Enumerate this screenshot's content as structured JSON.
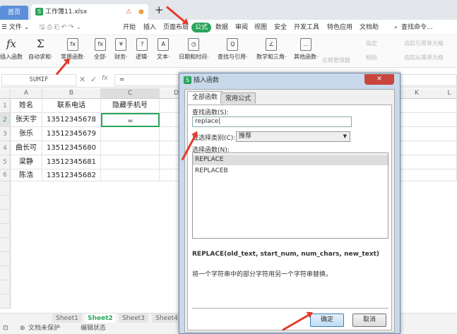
{
  "tabs": {
    "home": "首页",
    "workbook": "工作簿11.xlsx",
    "new_tab": "+",
    "warning": "⚠"
  },
  "menu": {
    "file": "☰ 文件 ⌄",
    "items": [
      "开始",
      "插入",
      "页面布局",
      "公式",
      "数据",
      "审阅",
      "视图",
      "安全",
      "开发工具",
      "特色应用",
      "文档助"
    ],
    "active": "公式",
    "search": "查找命令..."
  },
  "ribbon": {
    "items": [
      {
        "label": "插入函数",
        "icon": "fx"
      },
      {
        "label": "自动求和·",
        "icon": "Σ"
      },
      {
        "label": "常用函数·",
        "icon": "fx"
      },
      {
        "label": "全部·",
        "icon": "fx"
      },
      {
        "label": "财务·",
        "icon": "¥"
      },
      {
        "label": "逻辑·",
        "icon": "?"
      },
      {
        "label": "文本·",
        "icon": "A"
      },
      {
        "label": "日期和时间·",
        "icon": "◷"
      },
      {
        "label": "查找与引用·",
        "icon": "Q"
      },
      {
        "label": "数学和三角·",
        "icon": "∠"
      },
      {
        "label": "其他函数·",
        "icon": "…"
      }
    ],
    "disabled": [
      "名称管理器",
      "指定",
      "粘贴",
      "追踪引用单元格",
      "追踪从属单元格"
    ]
  },
  "formula_bar": {
    "name_box": "SUMIF",
    "cancel": "✕",
    "confirm": "✓",
    "fx": "fx",
    "value": "="
  },
  "grid": {
    "columns": [
      "A",
      "B",
      "C",
      "D"
    ],
    "right_columns": [
      "K",
      "L"
    ],
    "rows": [
      "1",
      "2",
      "3",
      "4",
      "5",
      "6"
    ],
    "cells": [
      [
        "姓名",
        "联系电话",
        "隐藏手机号"
      ],
      [
        "张天宇",
        "13512345678",
        "="
      ],
      [
        "张乐",
        "13512345679",
        ""
      ],
      [
        "曲长可",
        "13512345680",
        ""
      ],
      [
        "梁静",
        "13512345681",
        ""
      ],
      [
        "陈浩",
        "13512345682",
        ""
      ]
    ]
  },
  "sheets": {
    "tabs": [
      "Sheet1",
      "Sheet2",
      "Sheet3",
      "Sheet4"
    ],
    "active": "Sheet2"
  },
  "status": {
    "protect": "文档未保护",
    "mode": "编辑状态"
  },
  "dialog": {
    "title": "插入函数",
    "close": "✕",
    "tabs": [
      "全部函数",
      "常用公式"
    ],
    "search_label": "查找函数(S):",
    "search_value": "replace",
    "category_label": "或选择类别(C):",
    "category_value": "推荐",
    "list_label": "选择函数(N):",
    "functions": [
      "REPLACE",
      "REPLACEB"
    ],
    "selected": "REPLACE",
    "signature": "REPLACE(old_text, start_num, num_chars, new_text)",
    "description": "将一个字符串中的部分字符用另一个字符串替换。",
    "ok": "确定",
    "cancel": "取消"
  },
  "colors": {
    "accent": "#2aa55a",
    "home_tab": "#5b8fd9",
    "arrow": "#e43a2e"
  }
}
